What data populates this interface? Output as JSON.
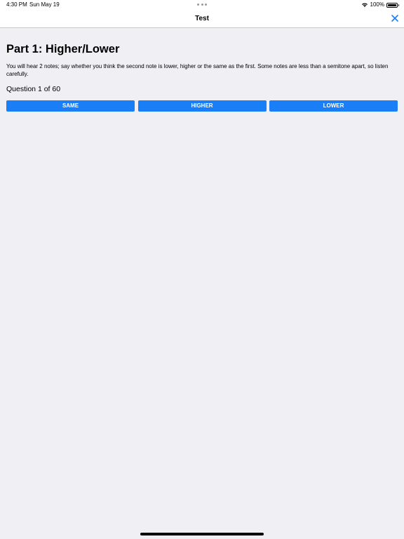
{
  "status_bar": {
    "time": "4:30 PM",
    "date": "Sun May 19",
    "battery_text": "100%",
    "battery_level": 1.0
  },
  "nav": {
    "title": "Test",
    "close_icon": "close-icon"
  },
  "content": {
    "part_title": "Part 1: Higher/Lower",
    "instructions": "You will hear 2 notes; say whether you think the second note is lower, higher or the same as the first. Some notes are less than a semitone apart, so listen carefully.",
    "question_label": "Question 1 of 60",
    "answers": [
      {
        "label": "SAME"
      },
      {
        "label": "HIGHER"
      },
      {
        "label": "LOWER"
      }
    ]
  },
  "colors": {
    "accent": "#1a7ef6",
    "background": "#efeff4"
  }
}
